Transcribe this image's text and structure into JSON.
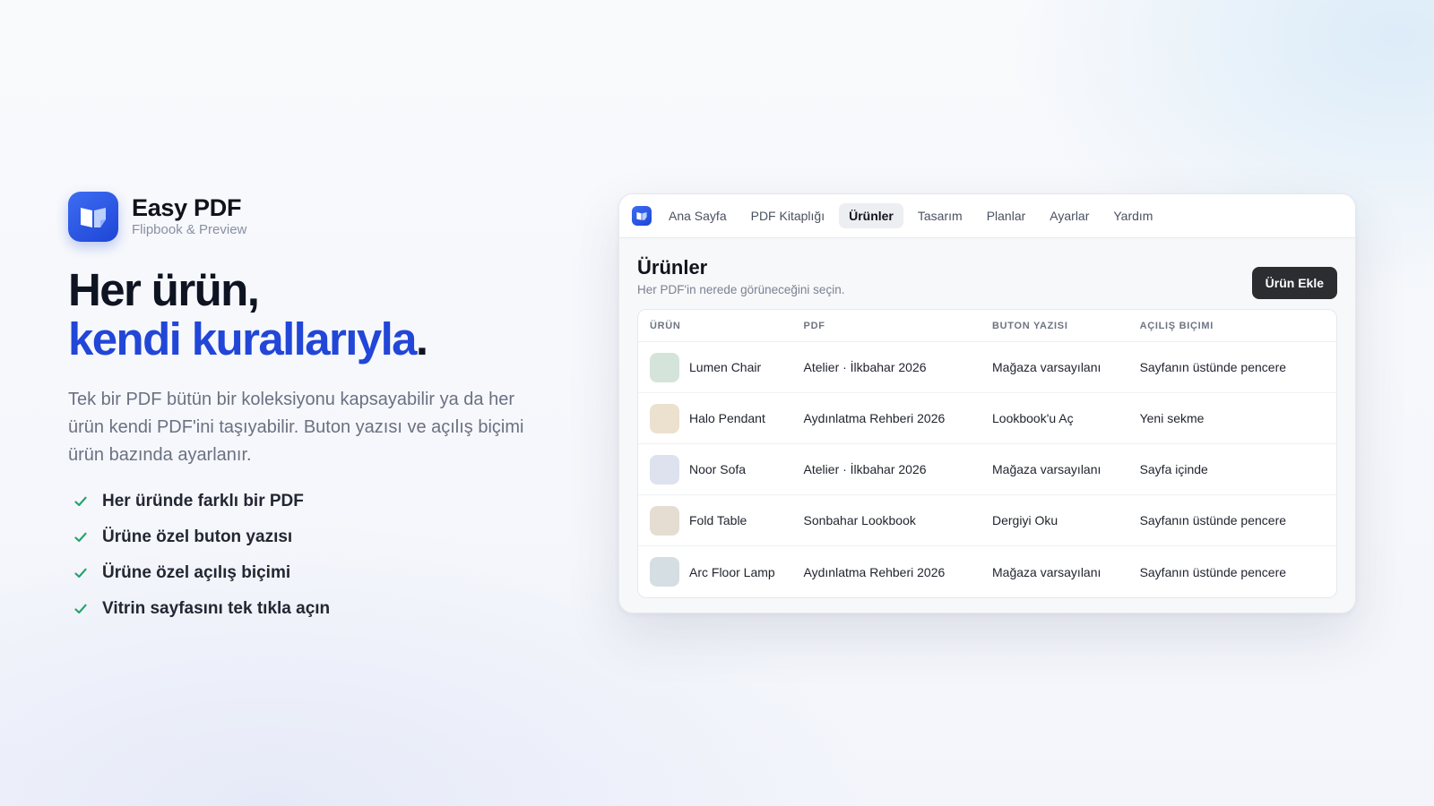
{
  "brand": {
    "name": "Easy PDF",
    "subtitle": "Flipbook & Preview",
    "accent": "#2146d8"
  },
  "hero": {
    "headline_line1": "Her ürün,",
    "headline_line2": "kendi kurallarıyla",
    "headline_period": ".",
    "description": "Tek bir PDF bütün bir koleksiyonu kapsayabilir ya da her ürün kendi PDF'ini taşıyabilir. Buton yazısı ve açılış biçimi ürün bazında ayarlanır.",
    "features": [
      "Her üründe farklı bir PDF",
      "Ürüne özel buton yazısı",
      "Ürüne özel açılış biçimi",
      "Vitrin sayfasını tek tıkla açın"
    ],
    "check_color": "#22a56a"
  },
  "window": {
    "nav": {
      "tabs": [
        "Ana Sayfa",
        "PDF Kitaplığı",
        "Ürünler",
        "Tasarım",
        "Planlar",
        "Ayarlar",
        "Yardım"
      ],
      "active_tab": "Ürünler"
    },
    "page": {
      "title": "Ürünler",
      "subtitle": "Her PDF'in nerede görüneceğini seçin.",
      "add_button": "Ürün Ekle"
    },
    "table": {
      "columns": [
        "ÜRÜN",
        "PDF",
        "BUTON YAZISI",
        "AÇILIŞ BIÇIMI"
      ],
      "rows": [
        {
          "product": "Lumen Chair",
          "pdf": "Atelier · İlkbahar 2026",
          "button_text": "Mağaza varsayılanı",
          "open_mode": "Sayfanın üstünde pencere",
          "swatch": "#d5e4da"
        },
        {
          "product": "Halo Pendant",
          "pdf": "Aydınlatma Rehberi 2026",
          "button_text": "Lookbook'u Aç",
          "open_mode": "Yeni sekme",
          "swatch": "#ece1cf"
        },
        {
          "product": "Noor Sofa",
          "pdf": "Atelier · İlkbahar 2026",
          "button_text": "Mağaza varsayılanı",
          "open_mode": "Sayfa içinde",
          "swatch": "#dde2ee"
        },
        {
          "product": "Fold Table",
          "pdf": "Sonbahar Lookbook",
          "button_text": "Dergiyi Oku",
          "open_mode": "Sayfanın üstünde pencere",
          "swatch": "#e6ddd2"
        },
        {
          "product": "Arc Floor Lamp",
          "pdf": "Aydınlatma Rehberi 2026",
          "button_text": "Mağaza varsayılanı",
          "open_mode": "Sayfanın üstünde pencere",
          "swatch": "#d4dee3"
        }
      ]
    }
  }
}
